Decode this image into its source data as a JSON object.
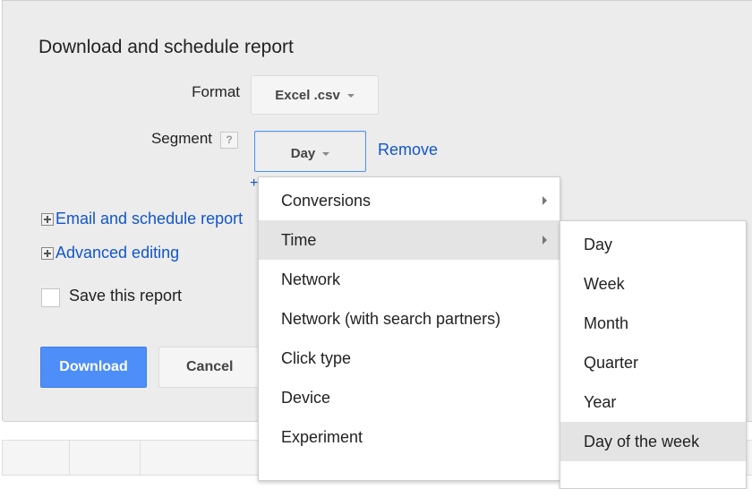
{
  "dialog": {
    "title": "Download and schedule report",
    "format": {
      "label": "Format",
      "value": "Excel .csv"
    },
    "segment": {
      "label": "Segment",
      "help": "?",
      "value": "Day",
      "remove_link": "Remove",
      "add_link": "+"
    },
    "expanders": [
      {
        "label": "Email and schedule report",
        "icon": "plus-box-icon"
      },
      {
        "label": "Advanced editing",
        "icon": "plus-box-icon"
      }
    ],
    "save_checkbox": {
      "label": "Save this report",
      "checked": false
    },
    "buttons": {
      "download": "Download",
      "cancel": "Cancel"
    }
  },
  "segment_menu": {
    "items": [
      {
        "label": "Conversions",
        "has_submenu": true,
        "highlighted": false
      },
      {
        "label": "Time",
        "has_submenu": true,
        "highlighted": true
      },
      {
        "label": "Network",
        "has_submenu": false,
        "highlighted": false
      },
      {
        "label": "Network (with search partners)",
        "has_submenu": false,
        "highlighted": false
      },
      {
        "label": "Click type",
        "has_submenu": false,
        "highlighted": false
      },
      {
        "label": "Device",
        "has_submenu": false,
        "highlighted": false
      },
      {
        "label": "Experiment",
        "has_submenu": false,
        "highlighted": false
      }
    ]
  },
  "time_submenu": {
    "items": [
      {
        "label": "Day",
        "highlighted": false
      },
      {
        "label": "Week",
        "highlighted": false
      },
      {
        "label": "Month",
        "highlighted": false
      },
      {
        "label": "Quarter",
        "highlighted": false
      },
      {
        "label": "Year",
        "highlighted": false
      },
      {
        "label": "Day of the week",
        "highlighted": true
      }
    ]
  },
  "colors": {
    "accent_blue": "#4d90fe",
    "link_blue": "#1155cc",
    "panel_bg": "#ececec",
    "menu_highlight": "#e4e4e4"
  }
}
